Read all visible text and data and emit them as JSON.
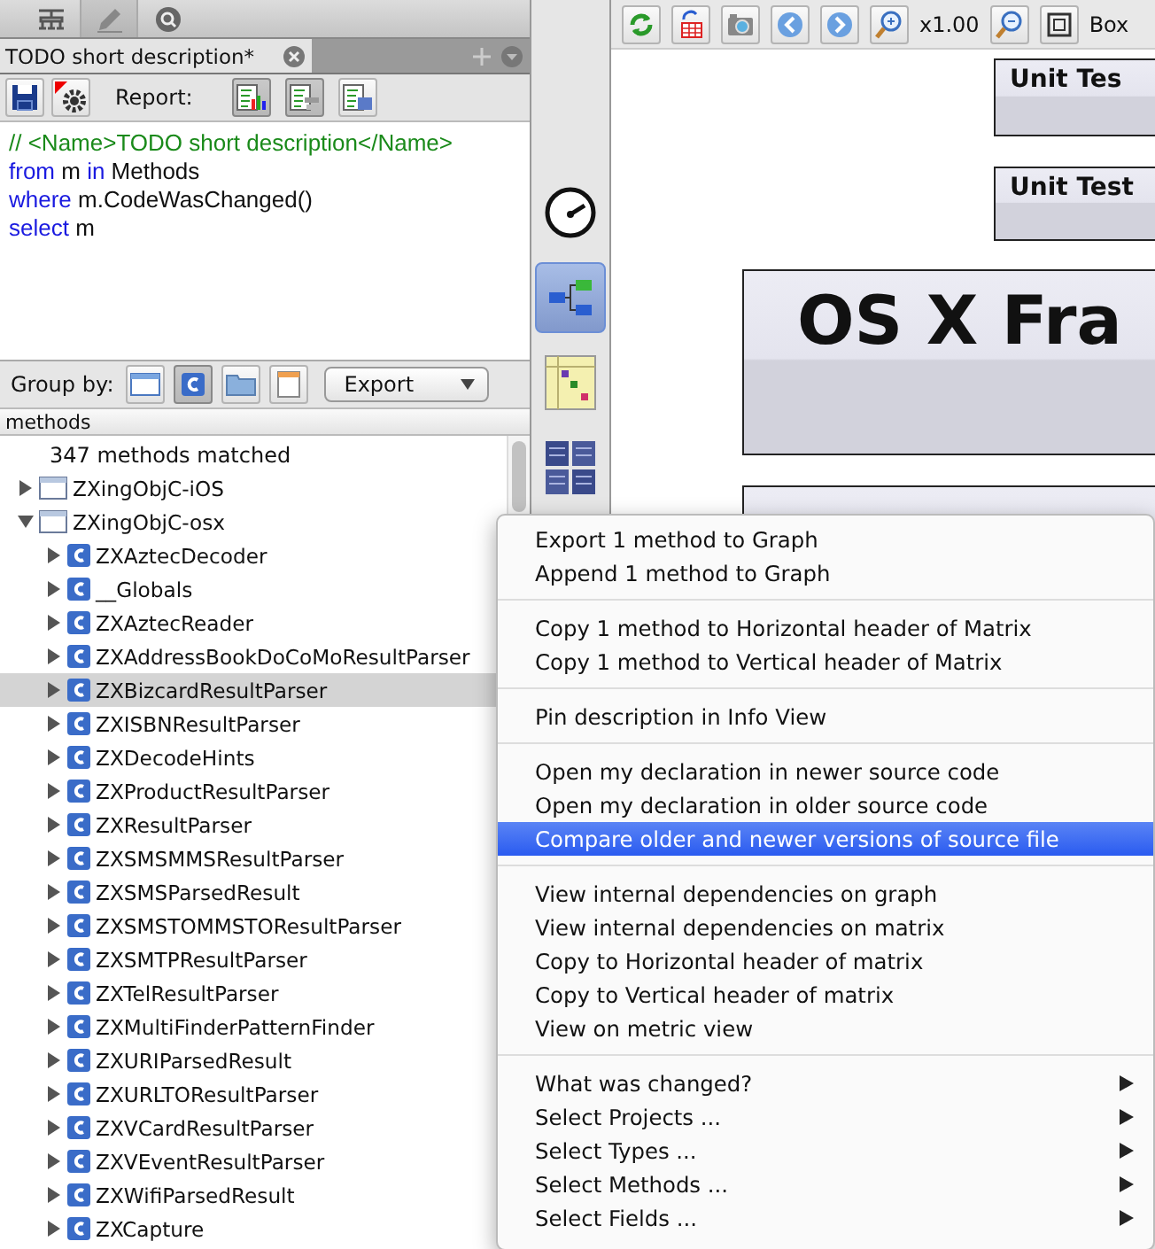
{
  "side_tabs": [
    {
      "kind": "graph",
      "selected": false
    },
    {
      "kind": "edit",
      "selected": true
    },
    {
      "kind": "search",
      "selected": false
    }
  ],
  "query_tab": {
    "title": "TODO short description*"
  },
  "query_toolbar": {
    "report_label": "Report:",
    "report_buttons": [
      {
        "kind": "chart",
        "selected": true
      },
      {
        "kind": "list",
        "selected": true
      },
      {
        "kind": "table",
        "selected": false
      }
    ]
  },
  "code_lines": [
    [
      {
        "kind": "comment",
        "text": "// <Name>TODO short description</Name>"
      }
    ],
    [
      {
        "kind": "keyword",
        "text": "from"
      },
      {
        "kind": "plain",
        "text": " m "
      },
      {
        "kind": "keyword",
        "text": "in"
      },
      {
        "kind": "plain",
        "text": " Methods"
      }
    ],
    [
      {
        "kind": "keyword",
        "text": "where"
      },
      {
        "kind": "plain",
        "text": " m.CodeWasChanged()"
      }
    ],
    [
      {
        "kind": "keyword",
        "text": "select"
      },
      {
        "kind": "plain",
        "text": " m"
      }
    ]
  ],
  "group_by": {
    "label": "Group by:",
    "options": [
      {
        "kind": "project",
        "selected": false
      },
      {
        "kind": "type",
        "selected": true
      },
      {
        "kind": "folder",
        "selected": false
      },
      {
        "kind": "file",
        "selected": false
      }
    ],
    "export_label": "Export"
  },
  "results": {
    "column": "methods",
    "summary": "347 methods matched",
    "tree": [
      {
        "label": "ZXingObjC-iOS",
        "expanded": false,
        "selected": false
      },
      {
        "label": "ZXingObjC-osx",
        "expanded": true,
        "selected": false,
        "children": [
          {
            "label": "ZXAztecDecoder",
            "expanded": false,
            "selected": false
          },
          {
            "label": "__Globals",
            "expanded": false,
            "selected": false
          },
          {
            "label": "ZXAztecReader",
            "expanded": false,
            "selected": false
          },
          {
            "label": "ZXAddressBookDoCoMoResultParser",
            "expanded": false,
            "selected": false
          },
          {
            "label": "ZXBizcardResultParser",
            "expanded": false,
            "selected": true
          },
          {
            "label": "ZXISBNResultParser",
            "expanded": false,
            "selected": false
          },
          {
            "label": "ZXDecodeHints",
            "expanded": false,
            "selected": false
          },
          {
            "label": "ZXProductResultParser",
            "expanded": false,
            "selected": false
          },
          {
            "label": "ZXResultParser",
            "expanded": false,
            "selected": false
          },
          {
            "label": "ZXSMSMMSResultParser",
            "expanded": false,
            "selected": false
          },
          {
            "label": "ZXSMSParsedResult",
            "expanded": false,
            "selected": false
          },
          {
            "label": "ZXSMSTOMMSTOResultParser",
            "expanded": false,
            "selected": false
          },
          {
            "label": "ZXSMTPResultParser",
            "expanded": false,
            "selected": false
          },
          {
            "label": "ZXTelResultParser",
            "expanded": false,
            "selected": false
          },
          {
            "label": "ZXMultiFinderPatternFinder",
            "expanded": false,
            "selected": false
          },
          {
            "label": "ZXURIParsedResult",
            "expanded": false,
            "selected": false
          },
          {
            "label": "ZXURLTOResultParser",
            "expanded": false,
            "selected": false
          },
          {
            "label": "ZXVCardResultParser",
            "expanded": false,
            "selected": false
          },
          {
            "label": "ZXVEventResultParser",
            "expanded": false,
            "selected": false
          },
          {
            "label": "ZXWifiParsedResult",
            "expanded": false,
            "selected": false
          },
          {
            "label": "ZXCapture",
            "expanded": false,
            "selected": false
          }
        ]
      }
    ]
  },
  "tool_strip": [
    {
      "kind": "metrics",
      "selected": false
    },
    {
      "kind": "graph",
      "selected": true
    },
    {
      "kind": "matrix",
      "selected": false
    },
    {
      "kind": "treemap",
      "selected": false
    }
  ],
  "graph_toolbar": {
    "buttons": [
      {
        "kind": "refresh"
      },
      {
        "kind": "export"
      },
      {
        "kind": "camera"
      },
      {
        "kind": "back"
      },
      {
        "kind": "forward"
      },
      {
        "kind": "zoom-in"
      }
    ],
    "zoom": "x1.00",
    "buttons_after": [
      {
        "kind": "zoom-out"
      },
      {
        "kind": "fit"
      }
    ],
    "box_label": "Box"
  },
  "graph_nodes": [
    {
      "label": "Unit Tes",
      "kind": "small"
    },
    {
      "label": "Unit Test",
      "kind": "small"
    },
    {
      "label": "OS X Fra",
      "kind": "large"
    },
    {
      "kind": "large"
    }
  ],
  "context_menu": {
    "sections": [
      [
        {
          "label": "Export 1 method to Graph",
          "selected": false,
          "submenu": false
        },
        {
          "label": "Append 1 method to Graph",
          "selected": false,
          "submenu": false
        }
      ],
      [
        {
          "label": "Copy 1 method to Horizontal header of Matrix",
          "selected": false,
          "submenu": false
        },
        {
          "label": "Copy 1 method to Vertical header of Matrix",
          "selected": false,
          "submenu": false
        }
      ],
      [
        {
          "label": "Pin description in Info View",
          "selected": false,
          "submenu": false
        }
      ],
      [
        {
          "label": "Open my declaration in newer source code",
          "selected": false,
          "submenu": false
        },
        {
          "label": "Open my declaration in older source code",
          "selected": false,
          "submenu": false
        },
        {
          "label": "Compare older and newer versions of source file",
          "selected": true,
          "submenu": false
        }
      ],
      [
        {
          "label": "View internal dependencies on graph",
          "selected": false,
          "submenu": false
        },
        {
          "label": "View internal dependencies on matrix",
          "selected": false,
          "submenu": false
        },
        {
          "label": "Copy to Horizontal header of matrix",
          "selected": false,
          "submenu": false
        },
        {
          "label": "Copy to Vertical header of matrix",
          "selected": false,
          "submenu": false
        },
        {
          "label": "View on metric view",
          "selected": false,
          "submenu": false
        }
      ],
      [
        {
          "label": "What was changed?",
          "selected": false,
          "submenu": true
        },
        {
          "label": "Select Projects ...",
          "selected": false,
          "submenu": true
        },
        {
          "label": "Select Types ...",
          "selected": false,
          "submenu": true
        },
        {
          "label": "Select Methods ...",
          "selected": false,
          "submenu": true
        },
        {
          "label": "Select Fields ...",
          "selected": false,
          "submenu": true
        }
      ]
    ]
  }
}
